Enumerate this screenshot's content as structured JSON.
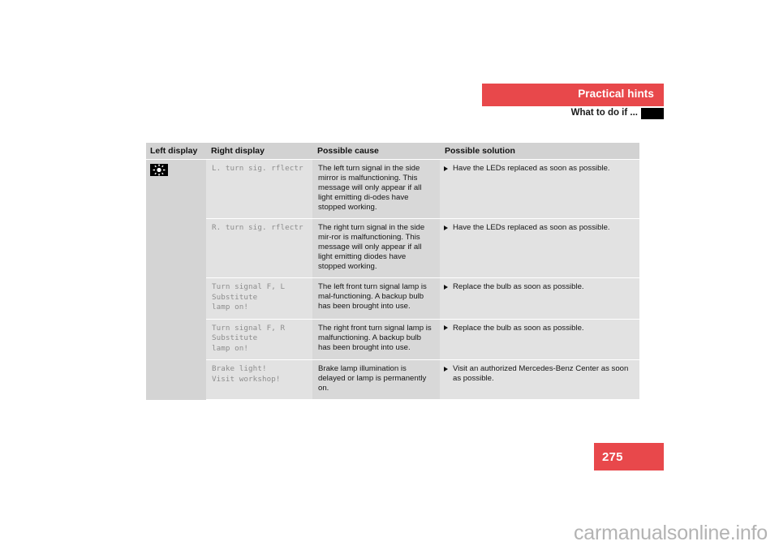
{
  "page": {
    "banner_title": "Practical hints",
    "subhead_title": "What to do if ...",
    "page_number": "275",
    "watermark": "carmanualsonline.info",
    "accent_color": "#e8484b",
    "tab_color": "#000000"
  },
  "table": {
    "headers": {
      "left_display": "Left display",
      "right_display": "Right display",
      "possible_cause": "Possible cause",
      "possible_solution": "Possible solution"
    },
    "left_display_icon": "warning-lamp-icon",
    "rows": [
      {
        "right_display": "L. turn sig. rflectr",
        "possible_cause": "The left turn signal in the side mirror is malfunctioning. This message will only appear if all light emitting di-odes have stopped working.",
        "possible_solution": "Have the LEDs replaced as soon as possible."
      },
      {
        "right_display": "R. turn sig. rflectr",
        "possible_cause": "The right turn signal in the side mir-ror is malfunctioning. This message will only appear if all light emitting diodes have stopped working.",
        "possible_solution": "Have the LEDs replaced as soon as possible."
      },
      {
        "right_display": "Turn signal F, L\nSubstitute\nlamp on!",
        "possible_cause": "The left front turn signal lamp is mal-functioning. A backup bulb has been brought into use.",
        "possible_solution": "Replace the bulb as soon as possible."
      },
      {
        "right_display": "Turn signal F, R\nSubstitute\nlamp on!",
        "possible_cause": "The right front turn signal lamp is malfunctioning. A backup bulb has been brought into use.",
        "possible_solution": "Replace the bulb as soon as possible."
      },
      {
        "right_display": "Brake light!\nVisit workshop!",
        "possible_cause": "Brake lamp illumination is delayed or lamp is permanently on.",
        "possible_solution": "Visit an authorized Mercedes-Benz Center as soon as possible."
      }
    ]
  }
}
